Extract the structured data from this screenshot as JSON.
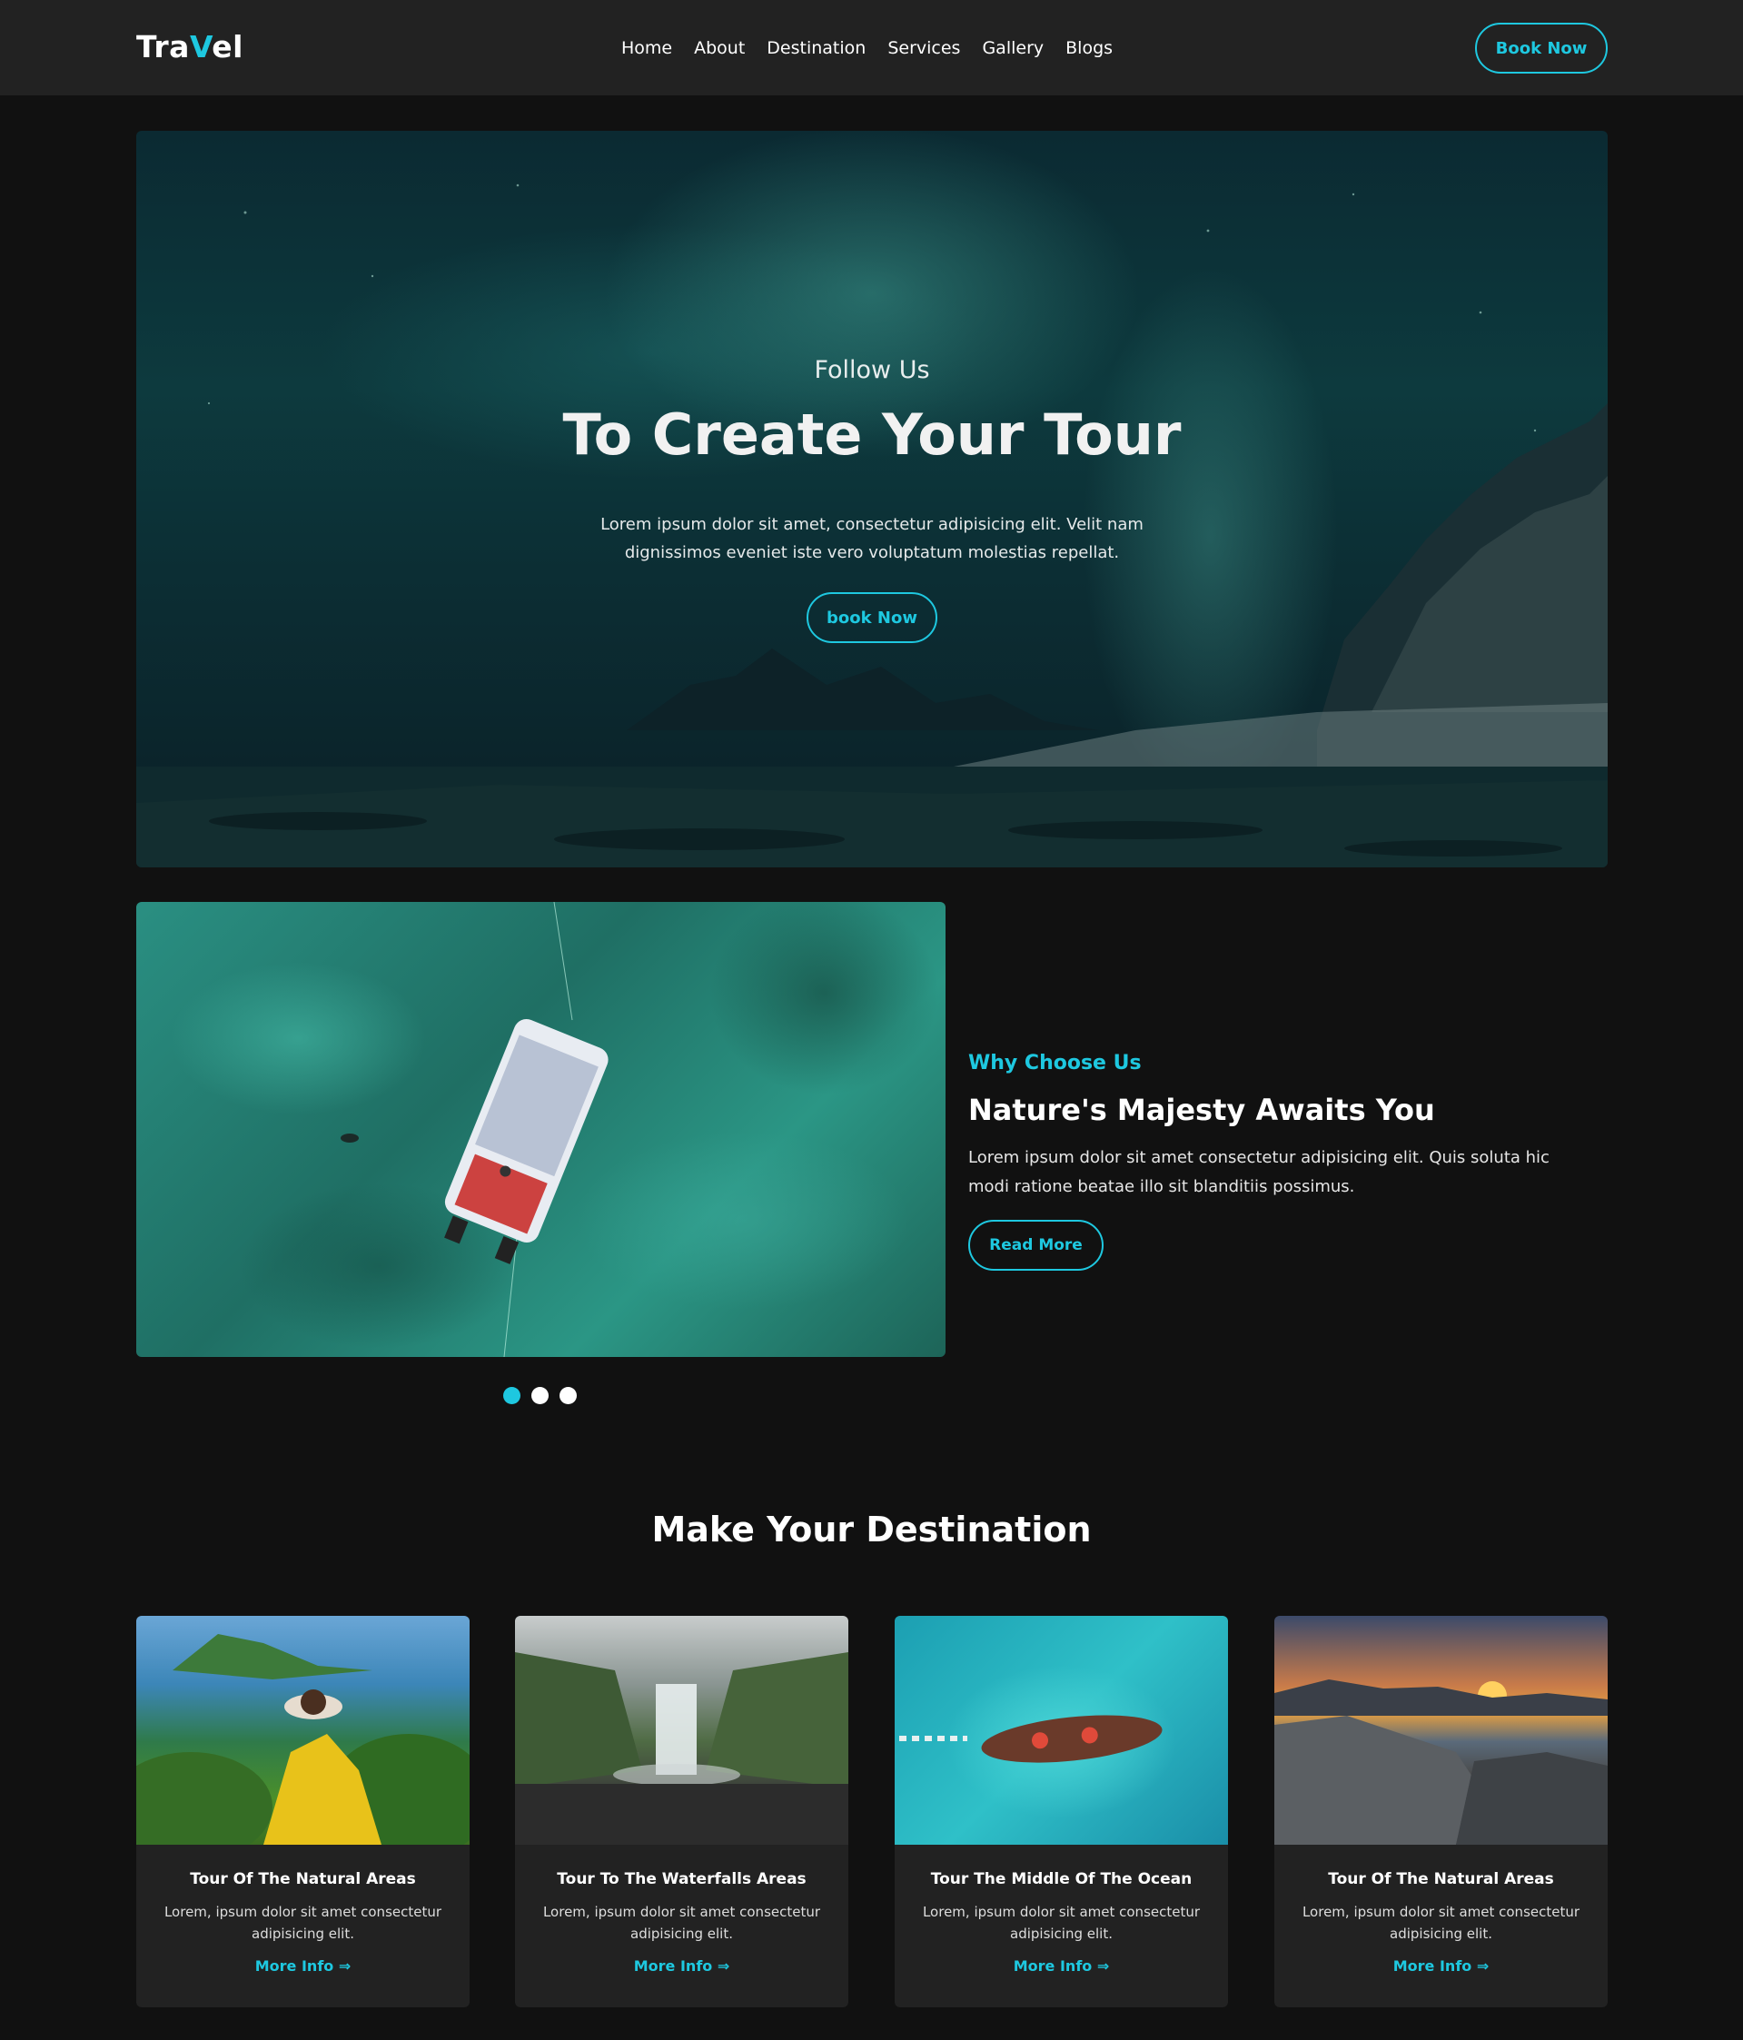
{
  "nav": {
    "logo_part1": "Tra",
    "logo_accent": "V",
    "logo_part2": "el",
    "links": [
      "Home",
      "About",
      "Destination",
      "Services",
      "Gallery",
      "Blogs"
    ],
    "cta": "Book Now"
  },
  "hero": {
    "subtitle": "Follow Us",
    "title": "To Create Your Tour",
    "text": "Lorem ipsum dolor sit amet, consectetur adipisicing elit. Velit nam dignissimos eveniet iste vero voluptatum molestias repellat.",
    "button": "book Now"
  },
  "why": {
    "tag": "Why Choose Us",
    "title": "Nature's Majesty Awaits You",
    "text": "Lorem ipsum dolor sit amet consectetur adipisicing elit. Quis soluta hic modi ratione beatae illo sit blanditiis possimus.",
    "button": "Read More",
    "slider_dots": 3,
    "active_dot": 1
  },
  "destinations": {
    "title": "Make Your Destination",
    "cards": [
      {
        "title": "Tour Of The Natural Areas",
        "text": "Lorem, ipsum dolor sit amet consectetur adipisicing elit.",
        "link": "More Info ⇒"
      },
      {
        "title": "Tour To The Waterfalls Areas",
        "text": "Lorem, ipsum dolor sit amet consectetur adipisicing elit.",
        "link": "More Info ⇒"
      },
      {
        "title": "Tour The Middle Of The Ocean",
        "text": "Lorem, ipsum dolor sit amet consectetur adipisicing elit.",
        "link": "More Info ⇒"
      },
      {
        "title": "Tour Of The Natural Areas",
        "text": "Lorem, ipsum dolor sit amet consectetur adipisicing elit.",
        "link": "More Info ⇒"
      }
    ]
  },
  "colors": {
    "accent": "#1ec8e0",
    "background": "#111111",
    "panel": "#222222"
  }
}
